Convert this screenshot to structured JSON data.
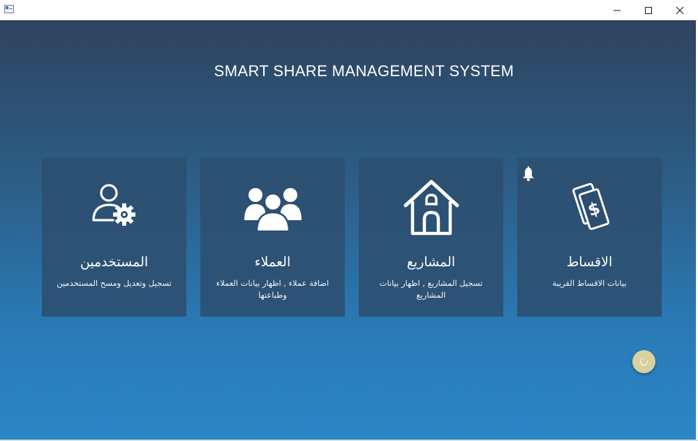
{
  "window": {
    "icon": "app-window-icon",
    "controls": [
      "minimize-icon",
      "maximize-icon",
      "close-icon"
    ]
  },
  "app": {
    "title": "SMART SHARE MANAGEMENT SYSTEM"
  },
  "tiles": [
    {
      "id": "users",
      "icon": "user-gear-icon",
      "title": "المستخدمين",
      "description": "تسجيل وتعديل ومسح المستخدمين"
    },
    {
      "id": "customers",
      "icon": "group-icon",
      "title": "العملاء",
      "description": "اضافة عملاء , اظهار بيانات العملاء وطباعتها"
    },
    {
      "id": "projects",
      "icon": "house-icon",
      "title": "المشاريع",
      "description": "تسجيل المشاريع , اظهار بيانات المشاريع"
    },
    {
      "id": "installments",
      "icon": "money-icon",
      "title": "الاقساط",
      "description": "بيانات الاقساط القريبة",
      "badge_icon": "bell-icon"
    }
  ],
  "fab": {
    "icon": "refresh-icon"
  },
  "colors": {
    "background_top": "#2f435f",
    "background_bottom": "#2a87c6",
    "tile": "#2c4e70",
    "fab": "#d8d2a0"
  }
}
